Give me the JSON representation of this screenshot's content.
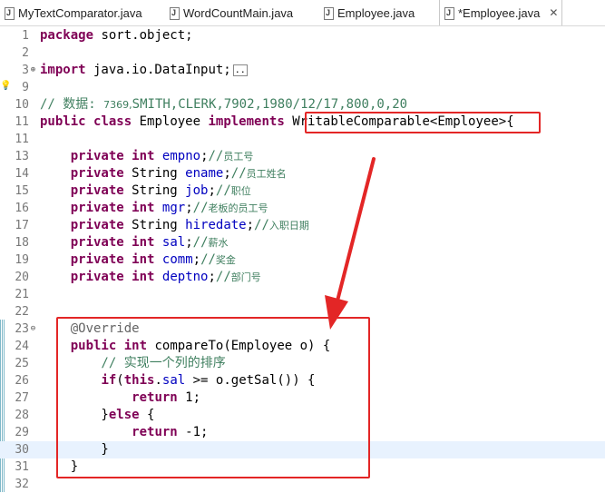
{
  "tabs": [
    {
      "label": "MyTextComparator.java",
      "active": false
    },
    {
      "label": "WordCountMain.java",
      "active": false
    },
    {
      "label": "Employee.java",
      "active": false
    },
    {
      "label": "*Employee.java",
      "active": true
    }
  ],
  "close_glyph": "✕",
  "editor": {
    "lines": [
      {
        "num": "1",
        "text": "package sort.object;"
      },
      {
        "num": "2",
        "text": ""
      },
      {
        "num": "3",
        "text": "import java.io.DataInput;"
      },
      {
        "num": "9",
        "text": ""
      },
      {
        "num": "10",
        "text": "// 数据: 7369,SMITH,CLERK,7902,1980/12/17,800,0,20"
      },
      {
        "num": "11",
        "text": "public class Employee implements WritableComparable<Employee>{"
      },
      {
        "num": "11",
        "text": ""
      },
      {
        "num": "13",
        "text": "private int empno;//员工号"
      },
      {
        "num": "14",
        "text": "private String ename;//员工姓名"
      },
      {
        "num": "15",
        "text": "private String job;//职位"
      },
      {
        "num": "16",
        "text": "private int mgr;//老板的员工号"
      },
      {
        "num": "17",
        "text": "private String hiredate;//入职日期"
      },
      {
        "num": "18",
        "text": "private int sal;//薪水"
      },
      {
        "num": "19",
        "text": "private int comm;//奖金"
      },
      {
        "num": "20",
        "text": "private int deptno;//部门号"
      },
      {
        "num": "21",
        "text": ""
      },
      {
        "num": "22",
        "text": ""
      },
      {
        "num": "23",
        "text": "@Override"
      },
      {
        "num": "24",
        "text": "public int compareTo(Employee o) {"
      },
      {
        "num": "25",
        "text": "// 实现一个列的排序"
      },
      {
        "num": "26",
        "text": "if(this.sal >= o.getSal()) {"
      },
      {
        "num": "27",
        "text": "return 1;"
      },
      {
        "num": "28",
        "text": "}else {"
      },
      {
        "num": "29",
        "text": "return -1;"
      },
      {
        "num": "30",
        "text": "}"
      },
      {
        "num": "31",
        "text": "}"
      },
      {
        "num": "32",
        "text": ""
      }
    ]
  },
  "colors": {
    "keyword": "#7f0055",
    "field": "#0000c0",
    "comment": "#3f7f5f",
    "annotation": "#646464",
    "highlight": "#e32626",
    "current_line": "#e8f2fe"
  }
}
